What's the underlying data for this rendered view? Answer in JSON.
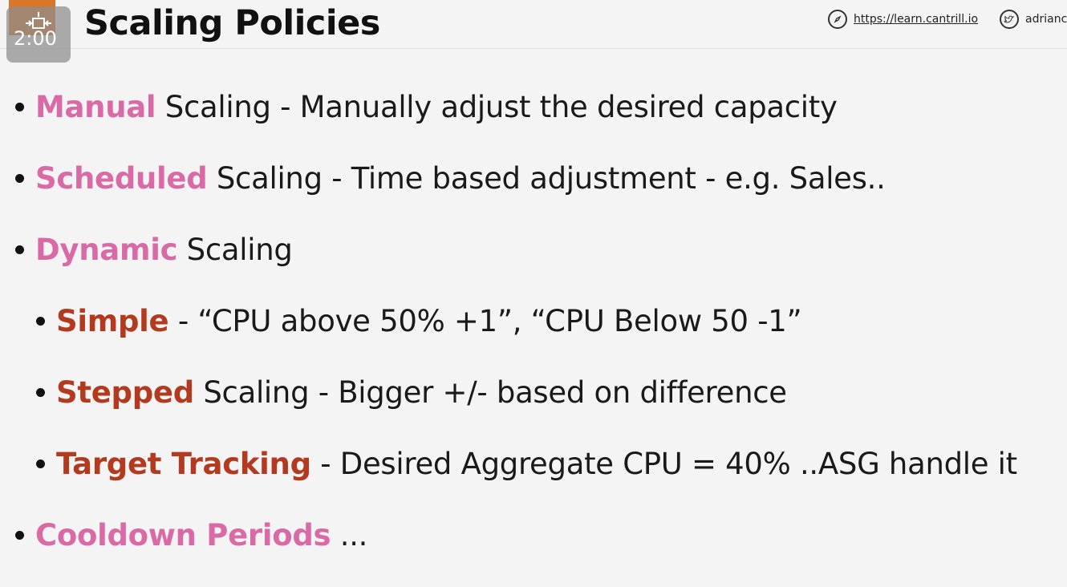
{
  "timer": {
    "value": "2:00"
  },
  "slide": {
    "title": "Scaling Policies"
  },
  "links": {
    "website": "https://learn.cantrill.io",
    "twitter": "adrianc"
  },
  "colors": {
    "primary_keyword": "#d96aa6",
    "secondary_keyword": "#b23a1f",
    "accent": "#d9762a"
  },
  "bullets": [
    {
      "keyword": "Manual",
      "text": " Scaling - Manually adjust the desired capacity"
    },
    {
      "keyword": "Scheduled",
      "text": " Scaling - Time based adjustment - e.g. Sales.."
    },
    {
      "keyword": "Dynamic",
      "text": " Scaling"
    },
    {
      "keyword": "Simple",
      "text": " - “CPU above 50% +1”, “CPU Below 50 -1”"
    },
    {
      "keyword": "Stepped",
      "text": " Scaling - Bigger +/- based on difference"
    },
    {
      "keyword": "Target Tracking",
      "text": " - Desired Aggregate CPU = 40% ..ASG handle it"
    },
    {
      "keyword": "Cooldown Periods",
      "text": " ..."
    }
  ],
  "icons": [
    "compass-icon",
    "twitter-icon",
    "timer-icon"
  ]
}
